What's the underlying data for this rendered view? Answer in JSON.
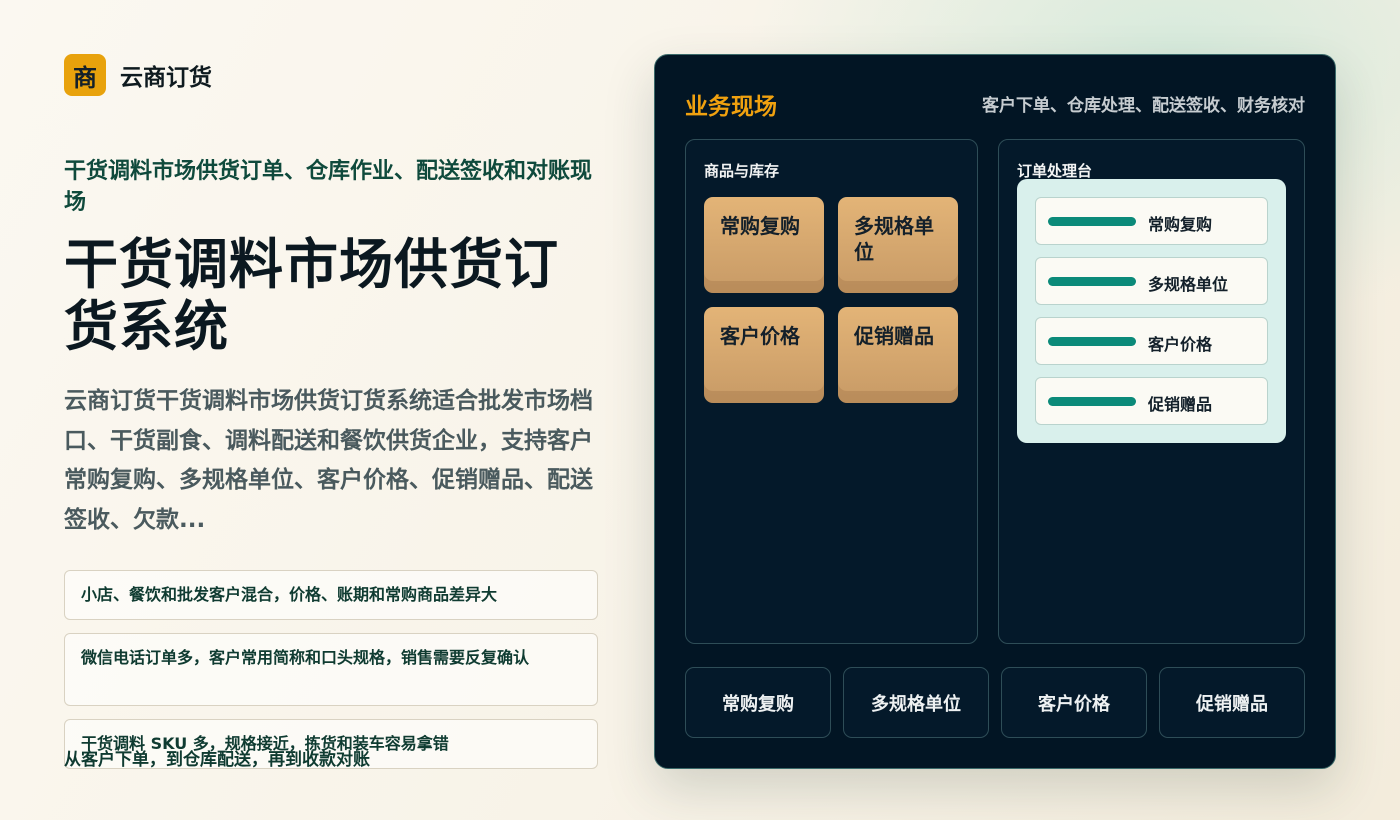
{
  "brand": {
    "badge": "商",
    "name": "云商订货"
  },
  "hero": {
    "kicker": "干货调料市场供货订单、仓库作业、配送签收和对账现场",
    "headline": "干货调料市场供货订货系统",
    "description": "云商订货干货调料市场供货订货系统适合批发市场档口、干货副食、调料配送和餐饮供货企业，支持客户常购复购、多规格单位、客户价格、促销赠品、配送签收、欠款..."
  },
  "pain_points": [
    "小店、餐饮和批发客户混合，价格、账期和常购商品差异大",
    "微信电话订单多，客户常用简称和口头规格，销售需要反复确认",
    "干货调料 SKU 多，规格接近，拣货和装车容易拿错"
  ],
  "caption": "从客户下单，到仓库配送，再到收款对账",
  "board": {
    "title": "业务现场",
    "flow": "客户下单、仓库处理、配送签收、财务核对",
    "inventory_panel": {
      "title": "商品与库存",
      "tiles": [
        "常购复购",
        "多规格单位",
        "客户价格",
        "促销赠品"
      ]
    },
    "order_panel": {
      "title": "订单处理台",
      "rows": [
        "常购复购",
        "多规格单位",
        "客户价格",
        "促销赠品"
      ]
    },
    "actions": [
      "常购复购",
      "多规格单位",
      "客户价格",
      "促销赠品"
    ]
  },
  "colors": {
    "accent": "#e8a20c",
    "board_bg": "#021524",
    "teal_bar": "#0b8a79",
    "tile": "#d6a870"
  }
}
